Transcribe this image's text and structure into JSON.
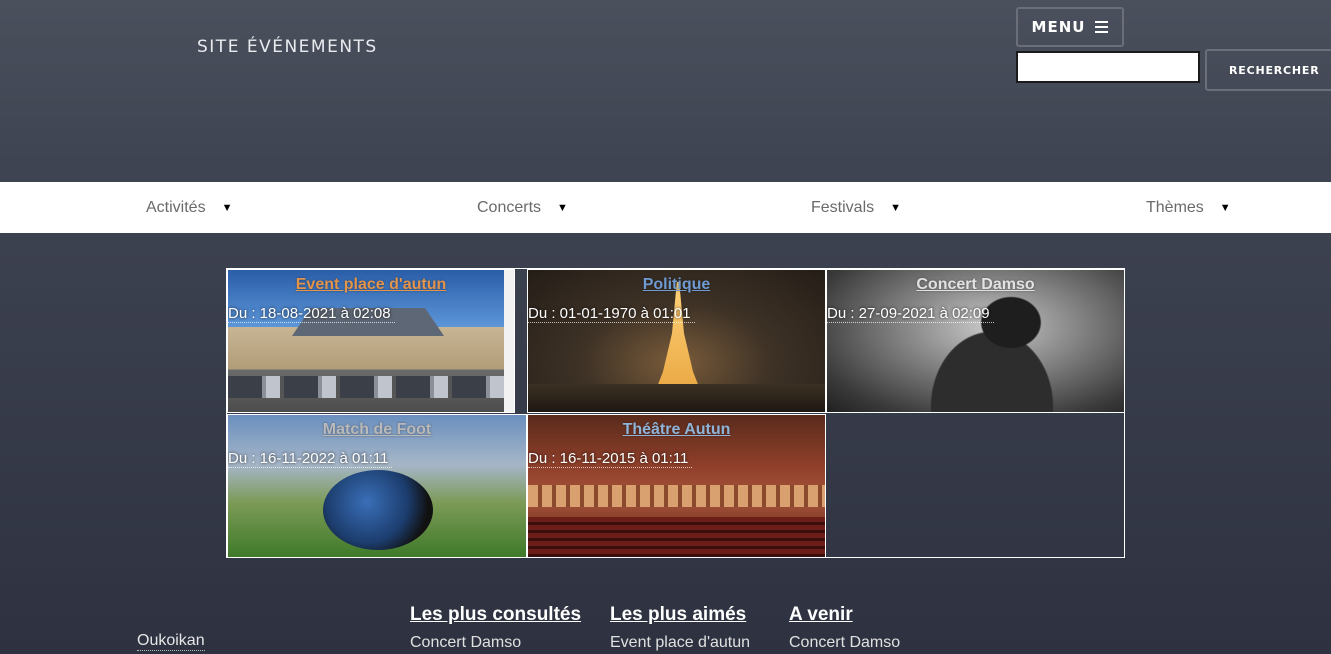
{
  "header": {
    "site_title": "SITE ÉVÉNEMENTS",
    "menu_label": "MENU",
    "search_button": "RECHERCHER",
    "search_value": ""
  },
  "nav": [
    {
      "label": "Activités"
    },
    {
      "label": "Concerts"
    },
    {
      "label": "Festivals"
    },
    {
      "label": "Thèmes"
    }
  ],
  "events": [
    {
      "title": "Event place d'autun",
      "date": "Du : 18-08-2021 à 02:08",
      "title_color": "#e3934a"
    },
    {
      "title": "Politique",
      "date": "Du : 01-01-1970 à 01:01",
      "title_color": "#6f9bd2"
    },
    {
      "title": "Concert Damso",
      "date": "Du : 27-09-2021 à 02:09",
      "title_color": "#e2e2e2"
    },
    {
      "title": "Match de Foot",
      "date": "Du : 16-11-2022 à 01:11",
      "title_color": "#b9b9b9"
    },
    {
      "title": "Théâtre Autun",
      "date": "Du : 16-11-2015 à 01:11",
      "title_color": "#8fb4da"
    }
  ],
  "footer": {
    "brand": "Oukoikan",
    "columns": [
      {
        "heading": "Les plus consultés",
        "first_item": "Concert Damso"
      },
      {
        "heading": "Les plus aimés",
        "first_item": "Event place d'autun"
      },
      {
        "heading": "A venir",
        "first_item": "Concert Damso"
      }
    ]
  },
  "colors": {
    "nav_bg": "#ffffff",
    "page_bg_top": "#4b505d",
    "page_bg_bottom": "#2e3240"
  }
}
